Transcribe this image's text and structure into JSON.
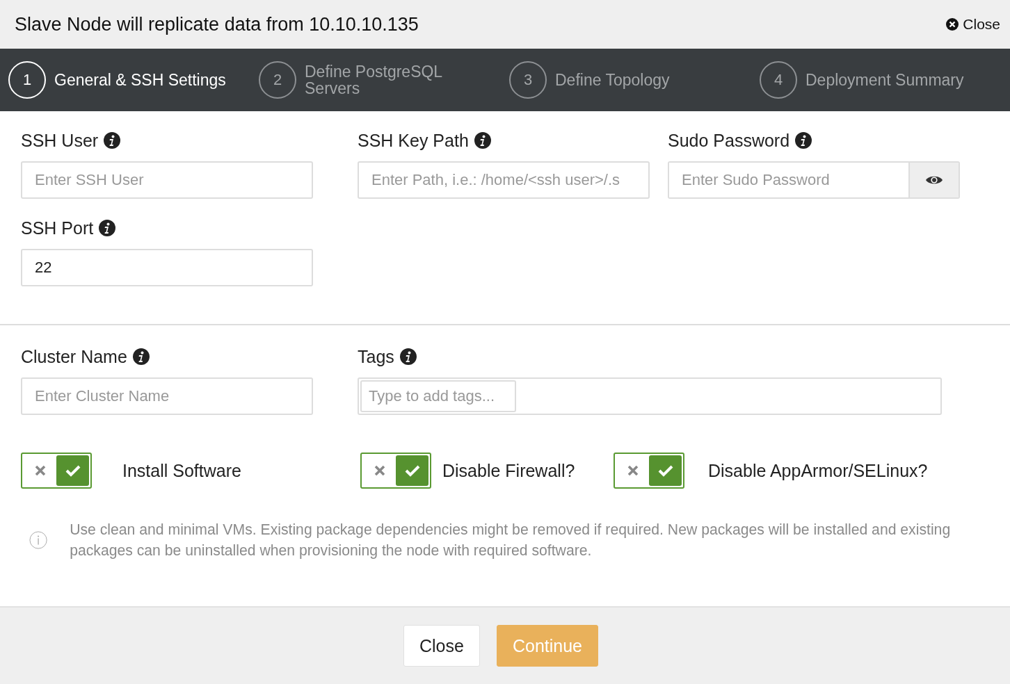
{
  "dialog": {
    "title": "Slave Node will replicate data from 10.10.10.135",
    "close_label": "Close"
  },
  "steps": [
    {
      "number": "1",
      "label": "General & SSH Settings",
      "selected": true
    },
    {
      "number": "2",
      "label": "Define PostgreSQL Servers",
      "selected": false
    },
    {
      "number": "3",
      "label": "Define Topology",
      "selected": false
    },
    {
      "number": "4",
      "label": "Deployment Summary",
      "selected": false
    }
  ],
  "ssh_fields": [
    {
      "label": "SSH User",
      "kind": "text",
      "placeholder": "Enter SSH User"
    },
    {
      "label": "SSH Key Path",
      "kind": "text",
      "placeholder": "Enter Path, i.e.: /home/<ssh user>/.s"
    },
    {
      "label": "Sudo Password",
      "kind": "password",
      "placeholder": "Enter Sudo Password"
    },
    {
      "label": "SSH Port",
      "kind": "text",
      "value": "22"
    }
  ],
  "cluster_fields": [
    {
      "label": "Cluster Name",
      "kind": "text",
      "placeholder": "Enter Cluster Name"
    },
    {
      "label": "Tags",
      "kind": "tags",
      "placeholder": "Type to add tags..."
    }
  ],
  "switches": [
    {
      "label": "Install Software",
      "on": true
    },
    {
      "label": "Disable Firewall?",
      "on": true
    },
    {
      "label": "Disable AppArmor/SELinux?",
      "on": true
    }
  ],
  "note": "Use clean and minimal VMs. Existing package dependencies might be removed if required. New packages will be installed and existing packages can be uninstalled when provisioning the node with required software.",
  "buttons": [
    {
      "label": "Close",
      "kind": "secondary"
    },
    {
      "label": "Continue",
      "kind": "primary"
    }
  ]
}
